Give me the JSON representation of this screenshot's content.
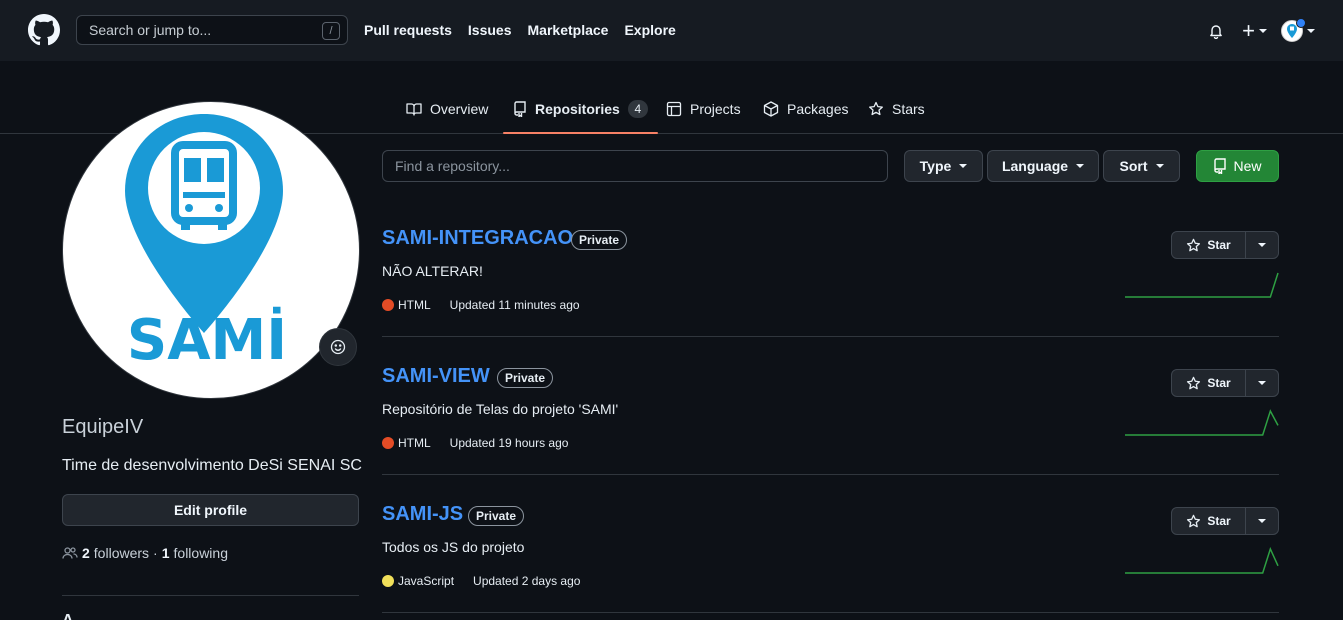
{
  "header": {
    "search_placeholder": "Search or jump to...",
    "search_shortcut": "/",
    "nav": [
      "Pull requests",
      "Issues",
      "Marketplace",
      "Explore"
    ],
    "icons": [
      "github-mark-icon",
      "bell-icon",
      "plus-icon",
      "avatar"
    ]
  },
  "tabs": [
    {
      "label": "Overview",
      "icon": "book-icon"
    },
    {
      "label": "Repositories",
      "icon": "repo-icon",
      "count": "4",
      "active": true
    },
    {
      "label": "Projects",
      "icon": "table-icon"
    },
    {
      "label": "Packages",
      "icon": "package-icon"
    },
    {
      "label": "Stars",
      "icon": "star-icon"
    }
  ],
  "profile": {
    "avatar_text": "SAMİ",
    "name": "EquipeIV",
    "bio": "Time de desenvolvimento DeSi SENAI SC",
    "edit_label": "Edit profile",
    "followers_count": "2",
    "followers_label": "followers",
    "separator": "·",
    "following_count": "1",
    "following_label": "following",
    "next_section_partial": "A..."
  },
  "filters": {
    "find_placeholder": "Find a repository...",
    "type_label": "Type",
    "language_label": "Language",
    "sort_label": "Sort",
    "new_label": "New"
  },
  "repos": [
    {
      "name": "SAMI-INTEGRACAO",
      "visibility": "Private",
      "description": "NÃO ALTERAR!",
      "language": "HTML",
      "language_color": "#e34c26",
      "updated": "Updated 11 minutes ago",
      "star_label": "Star",
      "activity": [
        0,
        0,
        0,
        0,
        0,
        0,
        0,
        0,
        0,
        0,
        0,
        0,
        0,
        0,
        0,
        0,
        0,
        0,
        0,
        0,
        1
      ]
    },
    {
      "name": "SAMI-VIEW",
      "visibility": "Private",
      "description": "Repositório de Telas do projeto 'SAMI'",
      "language": "HTML",
      "language_color": "#e34c26",
      "updated": "Updated 19 hours ago",
      "star_label": "Star",
      "activity": [
        0,
        0,
        0,
        0,
        0,
        0,
        0,
        0,
        0,
        0,
        0,
        0,
        0,
        0,
        0,
        0,
        0,
        0,
        0,
        1,
        0.4
      ]
    },
    {
      "name": "SAMI-JS",
      "visibility": "Private",
      "description": "Todos os JS do projeto",
      "language": "JavaScript",
      "language_color": "#f1e05a",
      "updated": "Updated 2 days ago",
      "star_label": "Star",
      "activity": [
        0,
        0,
        0,
        0,
        0,
        0,
        0,
        0,
        0,
        0,
        0,
        0,
        0,
        0,
        0,
        0,
        0,
        0,
        0,
        1,
        0.3
      ]
    }
  ],
  "colors": {
    "accent_link": "#4493f8",
    "tab_underline": "#f78166",
    "new_button": "#238636",
    "spark": "#2ea043"
  }
}
